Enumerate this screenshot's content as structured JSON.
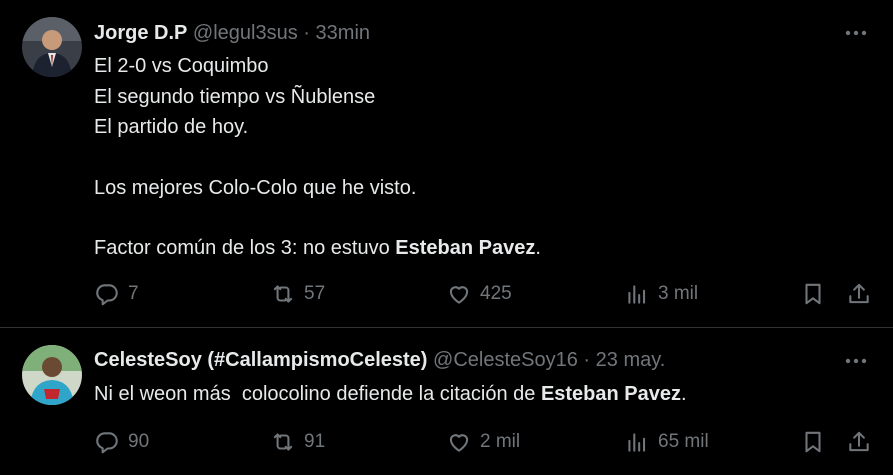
{
  "tweets": [
    {
      "name": "Jorge D.P",
      "handle": "@legul3sus",
      "sep": "·",
      "time": "33min",
      "lines": [
        "El 2-0 vs Coquimbo",
        "El segundo tiempo vs Ñublense",
        "El partido de hoy.",
        "Los mejores Colo-Colo que he visto.",
        "Factor común de los 3: no estuvo ",
        "Esteban Pavez",
        "."
      ],
      "replies": "7",
      "retweets": "57",
      "likes": "425",
      "views": "3 mil"
    },
    {
      "name": "CelesteSoy (#CallampismoCeleste)",
      "handle": "@CelesteSoy16",
      "sep": "·",
      "time": "23 may.",
      "lines": [
        "Ni el weon más  colocolino defiende la citación de ",
        "Esteban Pavez",
        "."
      ],
      "replies": "90",
      "retweets": "91",
      "likes": "2 mil",
      "views": "65 mil"
    }
  ],
  "icons": [
    "reply-icon",
    "retweet-icon",
    "like-icon",
    "views-icon",
    "bookmark-icon",
    "share-icon",
    "more-icon"
  ],
  "colors": {
    "background": "#000000",
    "text": "#e7e9ea",
    "muted": "#71767b",
    "divider": "#2f3336"
  }
}
